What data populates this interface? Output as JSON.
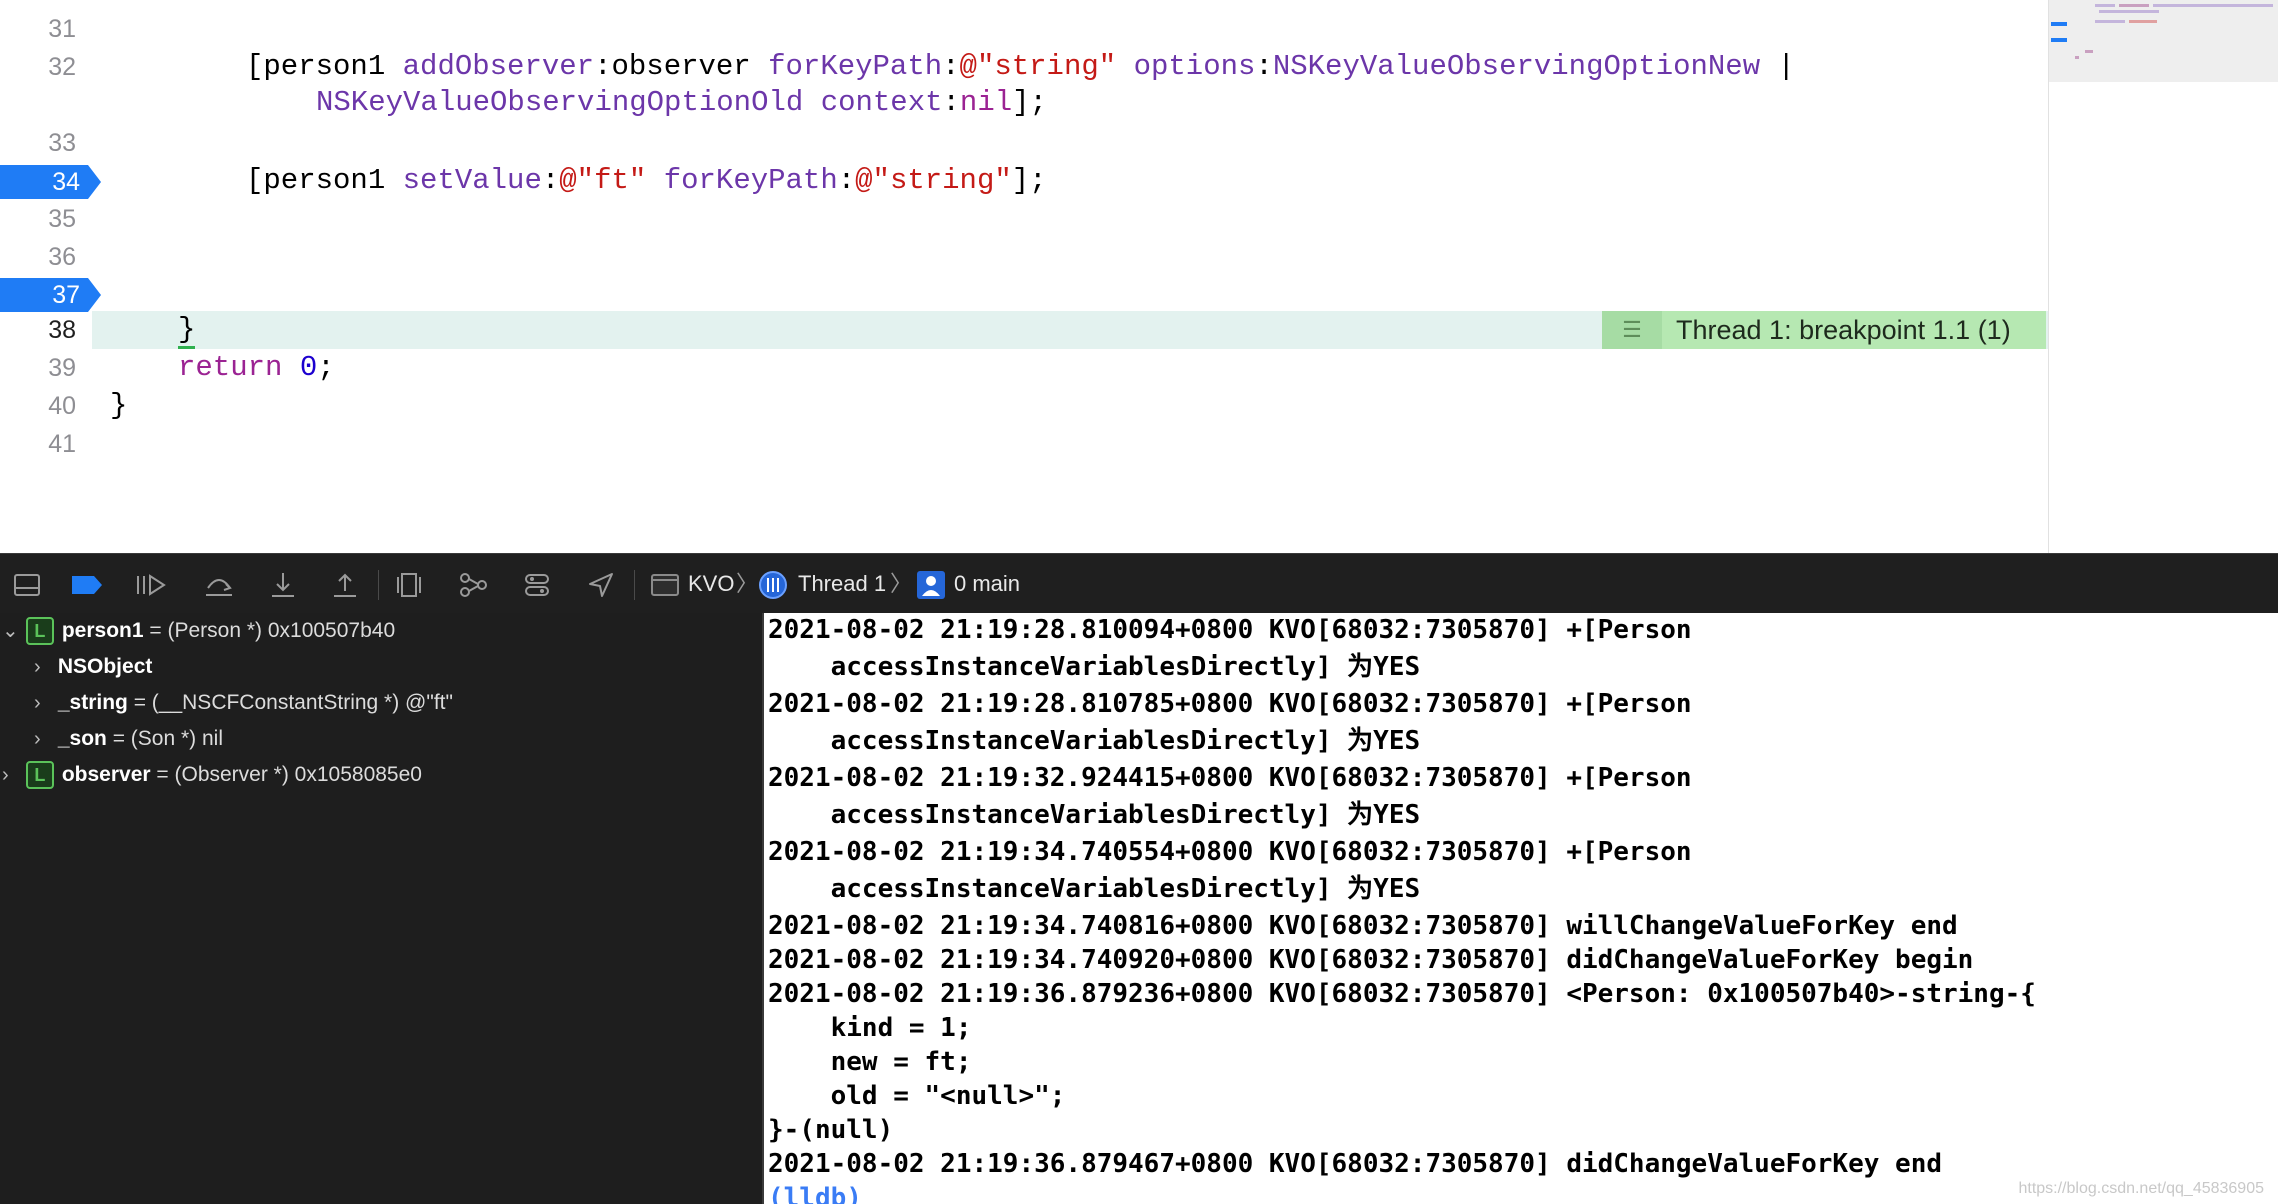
{
  "editor": {
    "lines": [
      {
        "num": "31"
      },
      {
        "num": "32"
      },
      {
        "num": "33"
      },
      {
        "num": "34",
        "breakpoint": true
      },
      {
        "num": "35"
      },
      {
        "num": "36"
      },
      {
        "num": "37",
        "breakpoint": true
      },
      {
        "num": "38",
        "current": true
      },
      {
        "num": "39"
      },
      {
        "num": "40"
      },
      {
        "num": "41"
      }
    ],
    "code": {
      "l32a": {
        "p1": "[person1 ",
        "m1": "addObserver",
        "p2": ":observer ",
        "m2": "forKeyPath",
        "p3": ":",
        "s1": "@\"string\"",
        "p4": " ",
        "m3": "options",
        "p5": ":",
        "c1": "NSKeyValueObservingOptionNew",
        "p6": " |"
      },
      "l32b": {
        "c2": "NSKeyValueObservingOptionOld",
        "p7": " ",
        "m4": "context",
        "p8": ":",
        "k1": "nil",
        "p9": "];"
      },
      "l34": {
        "p1": "[person1 ",
        "m1": "setValue",
        "p2": ":",
        "s1": "@\"ft\"",
        "p3": " ",
        "m2": "forKeyPath",
        "p4": ":",
        "s2": "@\"string\"",
        "p5": "];"
      },
      "l38": {
        "brace": "}"
      },
      "l39": {
        "kw": "return",
        "sp": " ",
        "num": "0",
        "semi": ";"
      },
      "l40": {
        "brace": "}"
      }
    },
    "breakpoint_banner": "Thread 1: breakpoint 1.1 (1)"
  },
  "debug_bar": {
    "target": "KVO",
    "thread": "Thread 1",
    "frame": "0 main"
  },
  "variables": [
    {
      "badge": "L",
      "name": "person1",
      "value": " = (Person *) 0x100507b40",
      "expanded": true
    },
    {
      "name": "NSObject",
      "value": ""
    },
    {
      "name": "_string",
      "value": " = (__NSCFConstantString *) @\"ft\""
    },
    {
      "name": "_son",
      "value": " = (Son *) nil"
    },
    {
      "badge": "L",
      "name": "observer",
      "value": " = (Observer *) 0x1058085e0",
      "expanded": false
    }
  ],
  "console": [
    "2021-08-02 21:19:28.810094+0800 KVO[68032:7305870] +[Person",
    "    accessInstanceVariablesDirectly] 为YES",
    "2021-08-02 21:19:28.810785+0800 KVO[68032:7305870] +[Person",
    "    accessInstanceVariablesDirectly] 为YES",
    "2021-08-02 21:19:32.924415+0800 KVO[68032:7305870] +[Person",
    "    accessInstanceVariablesDirectly] 为YES",
    "2021-08-02 21:19:34.740554+0800 KVO[68032:7305870] +[Person",
    "    accessInstanceVariablesDirectly] 为YES",
    "2021-08-02 21:19:34.740816+0800 KVO[68032:7305870] willChangeValueForKey end",
    "2021-08-02 21:19:34.740920+0800 KVO[68032:7305870] didChangeValueForKey begin",
    "2021-08-02 21:19:36.879236+0800 KVO[68032:7305870] <Person: 0x100507b40>-string-{",
    "    kind = 1;",
    "    new = ft;",
    "    old = \"<null>\";",
    "}-(null)",
    "2021-08-02 21:19:36.879467+0800 KVO[68032:7305870] didChangeValueForKey end"
  ],
  "console_prompt": "(lldb)",
  "watermark": "https://blog.csdn.net/qq_45836905",
  "colors": {
    "breakpoint": "#1f7cf5",
    "current_line": "#e3f2ef",
    "banner": "#b6e8b2"
  }
}
